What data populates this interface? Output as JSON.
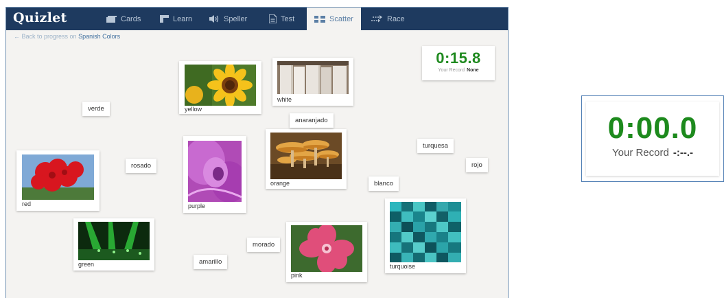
{
  "app": {
    "logo": "Quizlet"
  },
  "tabs": [
    {
      "label": "Cards",
      "icon": "cards-icon"
    },
    {
      "label": "Learn",
      "icon": "learn-icon"
    },
    {
      "label": "Speller",
      "icon": "speaker-icon"
    },
    {
      "label": "Test",
      "icon": "test-icon"
    },
    {
      "label": "Scatter",
      "icon": "scatter-icon",
      "active": true
    },
    {
      "label": "Race",
      "icon": "race-icon"
    }
  ],
  "breadcrumb": {
    "prefix": "← Back to progress on",
    "deck": "Spanish Colors"
  },
  "image_cards": [
    {
      "caption": "yellow"
    },
    {
      "caption": "white"
    },
    {
      "caption": "orange"
    },
    {
      "caption": "purple"
    },
    {
      "caption": "red"
    },
    {
      "caption": "green"
    },
    {
      "caption": "pink"
    },
    {
      "caption": "turquoise"
    }
  ],
  "word_cards": [
    "verde",
    "anaranjado",
    "turquesa",
    "rojo",
    "rosado",
    "blanco",
    "morado",
    "amarillo"
  ],
  "timer": {
    "time": "0:15.8",
    "record_label": "Your Record",
    "record_value": "None"
  },
  "zoom_timer": {
    "time": "0:00.0",
    "record_label": "Your Record",
    "record_value": "-:--.-"
  },
  "colors": {
    "nav": "#1e3a5f",
    "timer_green": "#1f8a1f",
    "background": "#f4f3f1"
  }
}
